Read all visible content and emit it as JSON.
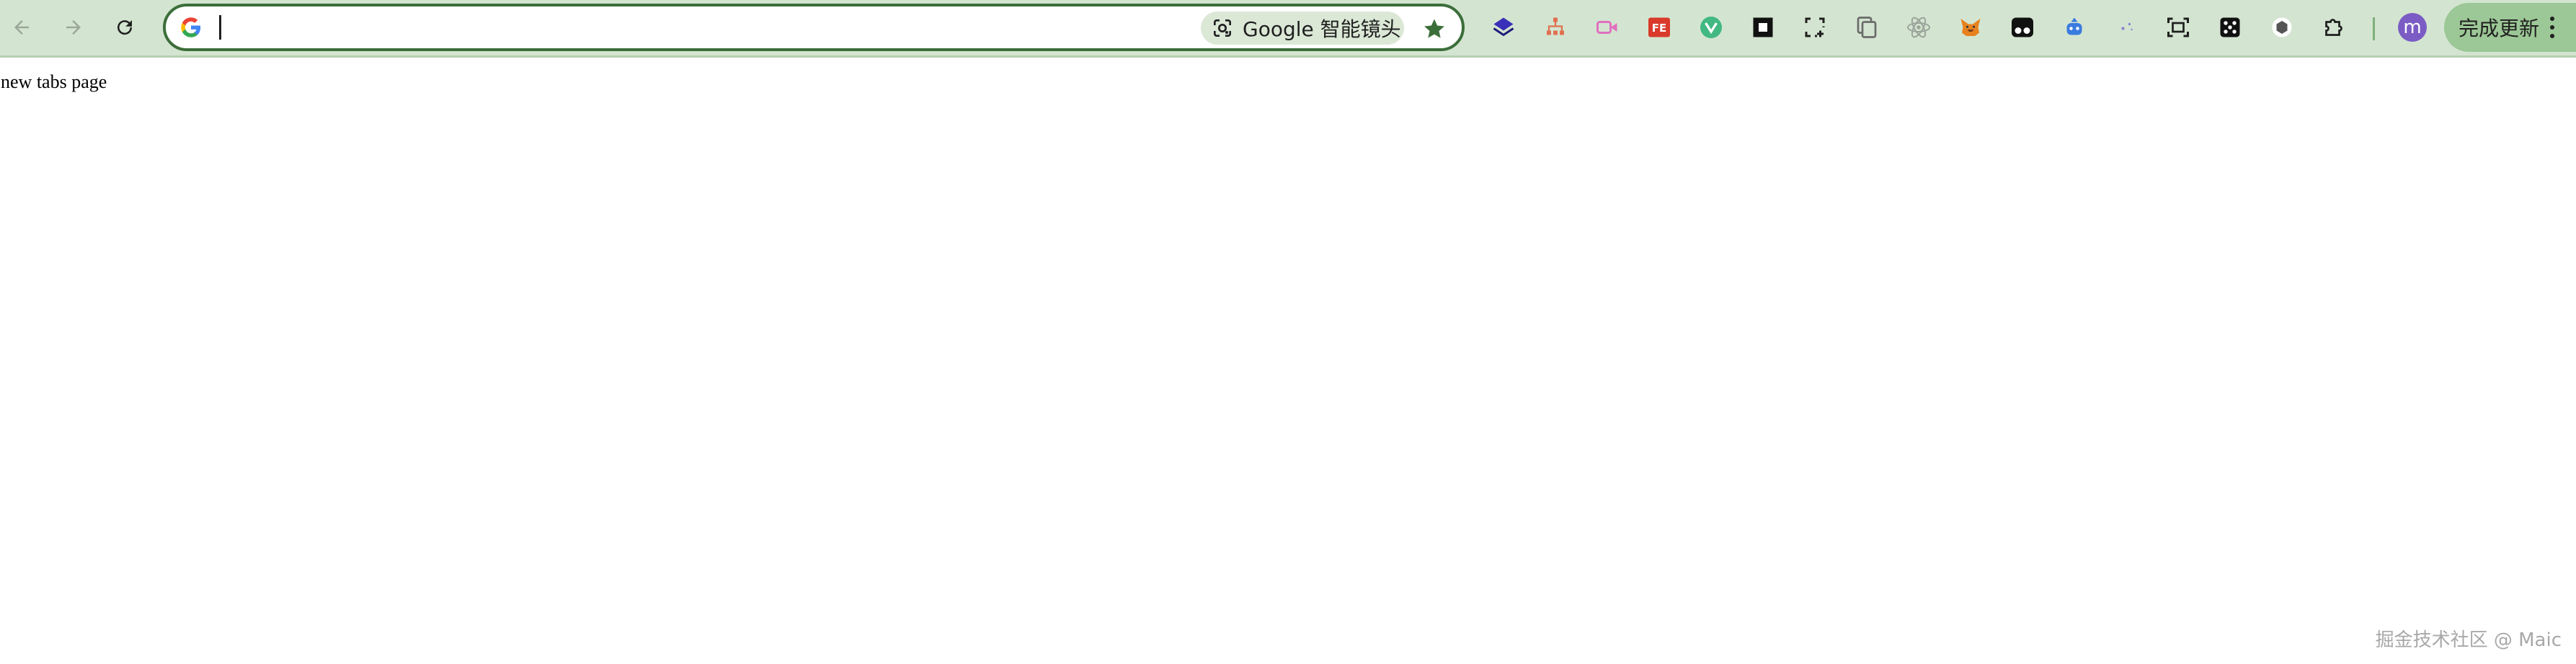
{
  "toolbar": {
    "back_icon": "arrow-left-icon",
    "forward_icon": "arrow-right-icon",
    "reload_icon": "reload-icon"
  },
  "omnibox": {
    "value": "",
    "placeholder": "",
    "engine_icon": "google-g-icon",
    "lens_label": "Google 智能镜头",
    "bookmark_icon": "star-icon"
  },
  "extensions": [
    "layers-extension-icon",
    "sitemap-extension-icon",
    "video-extension-icon",
    "fe-extension-icon",
    "vue-devtools-icon",
    "square-frame-extension-icon",
    "screenshot-crop-icon",
    "copy-pages-icon",
    "react-devtools-icon",
    "metamask-fox-icon",
    "tampermonkey-icon",
    "robot-extension-icon",
    "sparkle-extension-icon",
    "screen-capture-icon",
    "dice-extension-icon",
    "hexagon-extension-icon",
    "puzzle-extensions-icon"
  ],
  "profile": {
    "avatar_letter": "m"
  },
  "update_button": {
    "label": "完成更新",
    "menu_icon": "kebab-menu-icon"
  },
  "colors": {
    "toolbar_bg": "#d3e5d0",
    "omnibox_border": "#3c6e3a",
    "update_bg": "#9cc796",
    "avatar_bg": "#7b5cc4"
  },
  "page": {
    "body_text": "new tabs page",
    "watermark": "掘金技术社区 @ Maic"
  }
}
